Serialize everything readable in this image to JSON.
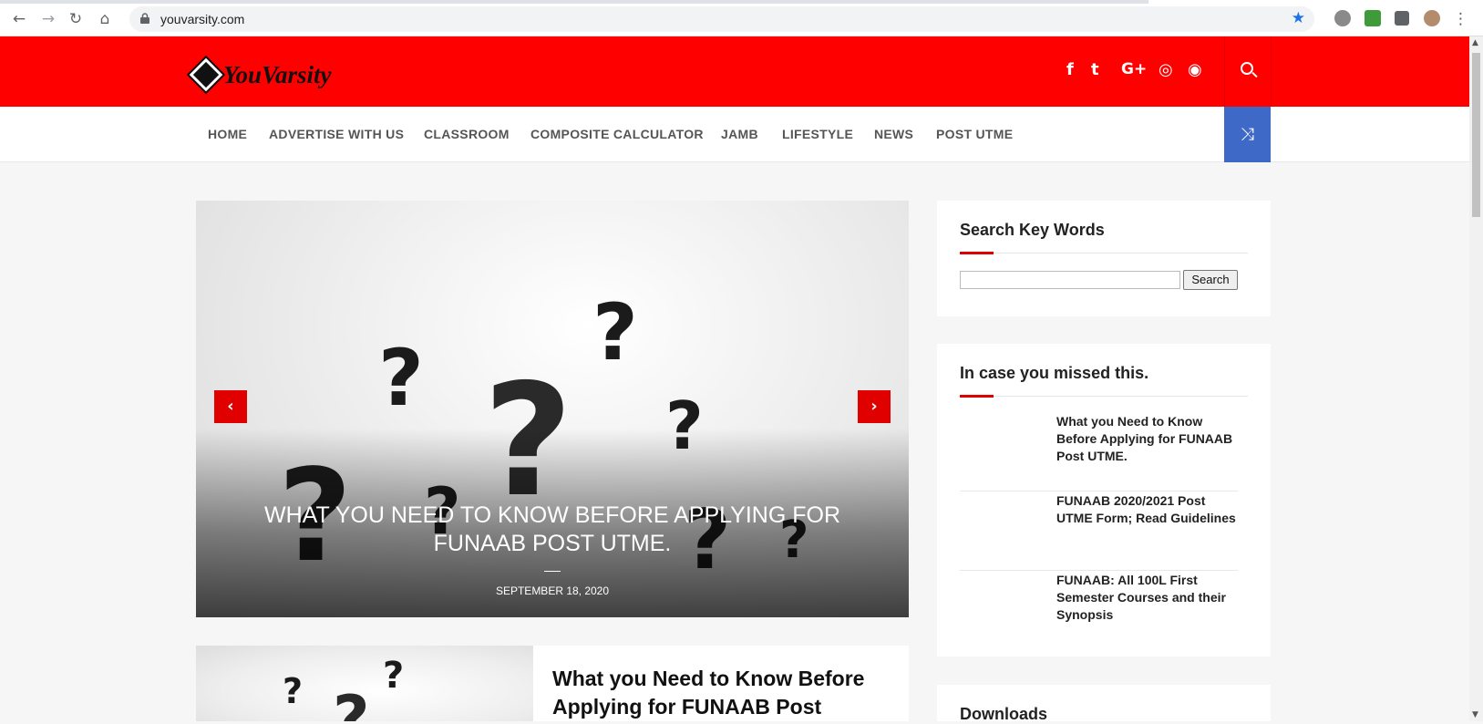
{
  "browser": {
    "url": "youvarsity.com",
    "back_icon": "←",
    "forward_icon": "→",
    "reload_icon": "↻",
    "home_icon": "⌂",
    "bookmark_icon": "★",
    "menu_icon": "⋮",
    "accent": "#1a73e8"
  },
  "header": {
    "logo_text": "YouVarsity",
    "brand_color": "#ff0000",
    "social": {
      "facebook": "f",
      "twitter": "t",
      "google_plus": "G+",
      "instagram": "◎",
      "rss": "◉"
    }
  },
  "nav": {
    "items": [
      "HOME",
      "ADVERTISE WITH US",
      "CLASSROOM",
      "COMPOSITE CALCULATOR",
      "JAMB",
      "LIFESTYLE",
      "NEWS",
      "POST UTME"
    ],
    "shuffle_icon": "⤨",
    "shuffle_color": "#3e69c7"
  },
  "slider": {
    "title": "WHAT YOU NEED TO KNOW BEFORE APPLYING FOR FUNAAB POST UTME.",
    "date": "SEPTEMBER 18, 2020",
    "prev_icon": "‹",
    "next_icon": "›"
  },
  "post": {
    "title": "What you Need to Know Before Applying for FUNAAB Post UTME."
  },
  "sidebar": {
    "search_widget": {
      "title": "Search Key Words",
      "button_label": "Search",
      "placeholder": ""
    },
    "missed_widget": {
      "title": "In case you missed this.",
      "items": [
        "What you Need to Know Before Applying for FUNAAB Post UTME.",
        "FUNAAB 2020/2021 Post UTME Form; Read Guidelines",
        "FUNAAB: All 100L First Semester Courses and their Synopsis"
      ]
    },
    "downloads_widget": {
      "title": "Downloads"
    }
  }
}
